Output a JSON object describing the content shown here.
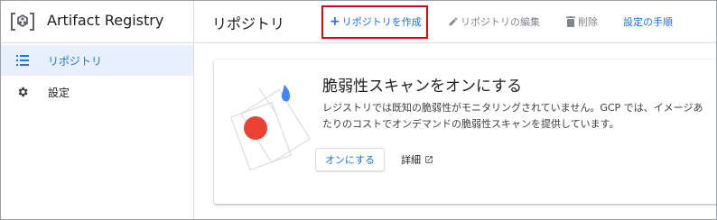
{
  "app": {
    "title": "Artifact Registry"
  },
  "sidebar": {
    "items": [
      {
        "label": "リポジトリ",
        "icon": "list-icon",
        "active": true
      },
      {
        "label": "設定",
        "icon": "gear-icon",
        "active": false
      }
    ]
  },
  "header": {
    "page_title": "リポジトリ",
    "create_label": "リポジトリを作成",
    "edit_label": "リポジトリの編集",
    "delete_label": "削除",
    "guide_label": "設定の手順"
  },
  "card": {
    "title": "脆弱性スキャンをオンにする",
    "description": "レジストリでは既知の脆弱性がモニタリングされていません。GCP では、イメージあたりのコストでオンデマンドの脆弱性スキャンを提供しています。",
    "enable_label": "オンにする",
    "details_label": "詳細"
  },
  "colors": {
    "accent": "#1a73e8",
    "active_bg": "#e8f0fe",
    "highlight": "#e3000f",
    "illustration_red": "#ea4335",
    "illustration_blue": "#4285f4"
  }
}
